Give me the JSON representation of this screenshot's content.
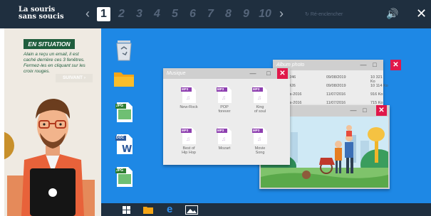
{
  "app": {
    "logo_line1": "La souris",
    "logo_line2": "sans soucis",
    "steps": [
      "1",
      "2",
      "3",
      "4",
      "5",
      "6",
      "7",
      "8",
      "9",
      "10"
    ],
    "active_step": "1",
    "hint": "Ré-enclencher"
  },
  "situation": {
    "title": "EN SITUATION",
    "text": "Alain a reçu un email, il est caché derrière ces 3 fenêtres. Fermez-les en cliquant sur les croix rouges.",
    "next_label": "SUIVANT"
  },
  "music_window": {
    "title": "Musique",
    "files": [
      {
        "badge": "MP3",
        "label1": "New-Rock",
        "label2": ""
      },
      {
        "badge": "MP3",
        "label1": "POP",
        "label2": "forever"
      },
      {
        "badge": "MP3",
        "label1": "King",
        "label2": "of soul"
      },
      {
        "badge": "MP3",
        "label1": "Best of",
        "label2": "Hip Hop"
      },
      {
        "badge": "MP3",
        "label1": "Mozart",
        "label2": ""
      },
      {
        "badge": "MP3",
        "label1": "Movie",
        "label2": "Song"
      }
    ]
  },
  "album_window": {
    "title": "Album photo",
    "rows": [
      {
        "name": "ge-15246",
        "date": "09/08/2019",
        "size": "10 321 Ko"
      },
      {
        "name": "ge-11426",
        "date": "09/08/2019",
        "size": "10 114 Ko"
      },
      {
        "name": "cances-2016",
        "date": "11/07/2016",
        "size": "916 Ko"
      },
      {
        "name": "cances-2016",
        "date": "11/07/2016",
        "size": "715 Ko"
      }
    ]
  },
  "desktop_icons": [
    {
      "icon": "recycle-bin-icon",
      "badge": ""
    },
    {
      "icon": "folder-icon",
      "badge": ""
    },
    {
      "icon": "jpg-file-icon",
      "badge": "JPG"
    },
    {
      "icon": "doc-file-icon",
      "badge": "DOC"
    },
    {
      "icon": "jpg-file-icon",
      "badge": "JPG"
    }
  ],
  "colors": {
    "topbar": "#1f2f3f",
    "desktop": "#1e88e5",
    "close_red": "#e0184a",
    "mp3_purple": "#8e3fb0",
    "situation_green": "#1f5d3d"
  }
}
